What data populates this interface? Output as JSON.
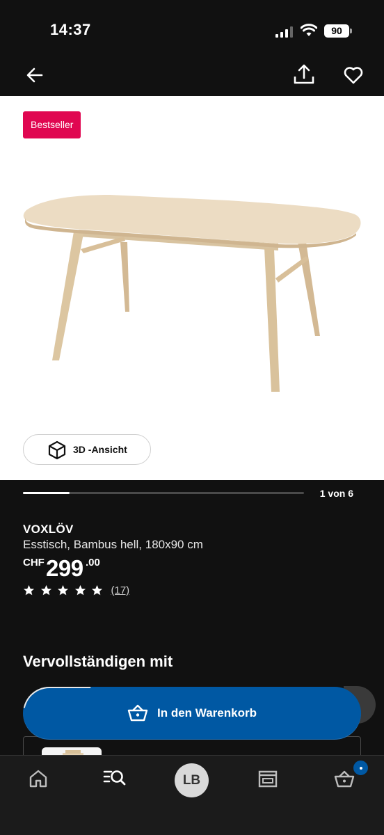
{
  "status_bar": {
    "time": "14:37",
    "battery_level": "90",
    "icons": [
      "signal-icon",
      "wifi-icon",
      "battery-icon"
    ]
  },
  "nav": {
    "icons": [
      "back-arrow-icon",
      "share-icon",
      "heart-icon"
    ]
  },
  "product_image": {
    "badge": "Bestseller",
    "view_3d_label": "3D -Ansicht",
    "image_position": 1,
    "image_total": 6,
    "image_counter": "1 von 6"
  },
  "product": {
    "name": "VOXLÖV",
    "description": "Esstisch, Bambus hell, 180x90 cm",
    "price_currency": "CHF",
    "price_main": "299",
    "price_cents": ".00",
    "rating_stars": 5,
    "review_count": "(17)"
  },
  "complete_section": {
    "title": "Vervollständigen mit"
  },
  "cart_button": {
    "label": "In den Warenkorb"
  },
  "tab_bar": {
    "avatar_initials": "LB",
    "items": [
      "home-icon",
      "search-icon",
      "avatar",
      "stores-icon",
      "cart-icon"
    ]
  },
  "colors": {
    "background": "#111111",
    "accent_blue": "#0058a3",
    "badge_red": "#e00751",
    "image_bg": "#ffffff"
  }
}
